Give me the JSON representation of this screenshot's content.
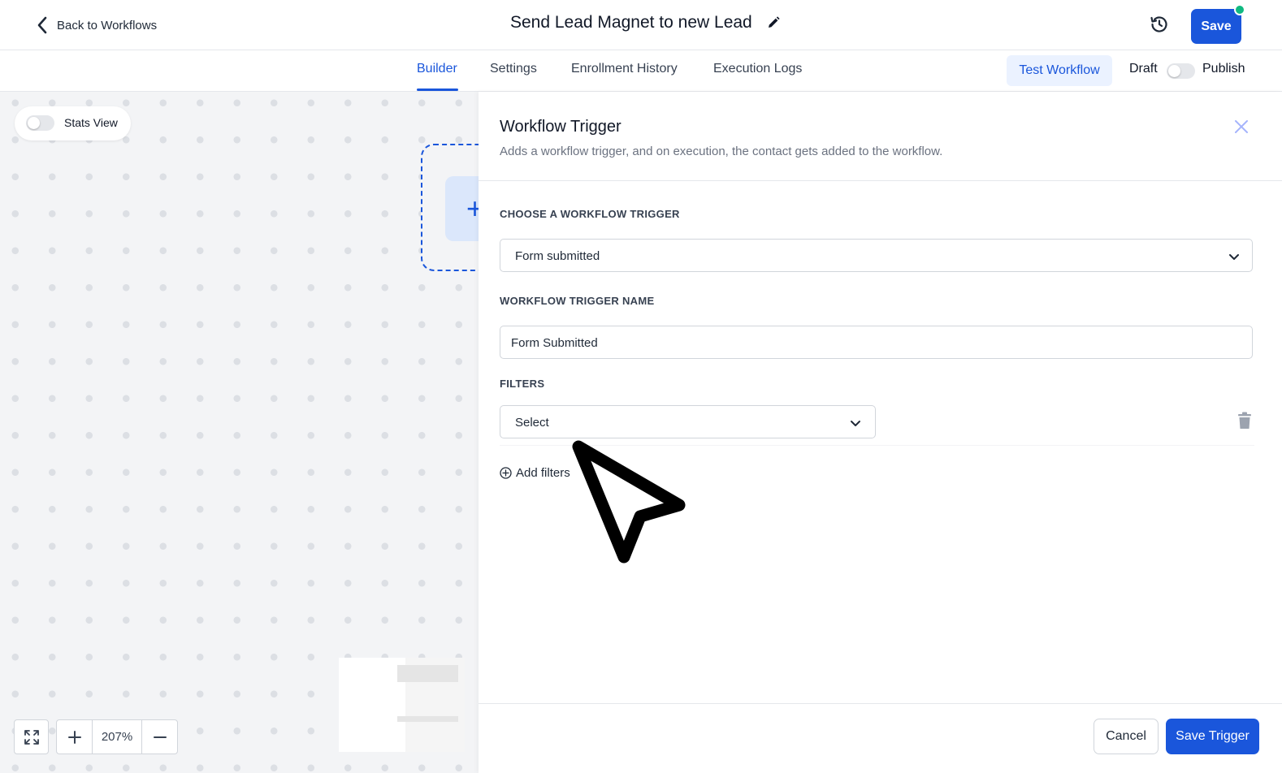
{
  "header": {
    "back_label": "Back to Workflows",
    "workflow_title": "Send Lead Magnet to new Lead",
    "save_label": "Save"
  },
  "tabs": [
    {
      "label": "Builder",
      "active": true
    },
    {
      "label": "Settings",
      "active": false
    },
    {
      "label": "Enrollment History",
      "active": false
    },
    {
      "label": "Execution Logs",
      "active": false
    }
  ],
  "actions": {
    "test_workflow_label": "Test Workflow",
    "draft_label": "Draft",
    "publish_label": "Publish",
    "published": false
  },
  "canvas": {
    "stats_view_label": "Stats View",
    "stats_view_on": false,
    "zoom_level": "207%"
  },
  "panel": {
    "title": "Workflow Trigger",
    "subtitle": "Adds a workflow trigger, and on execution, the contact gets added to the workflow.",
    "choose_trigger_label": "CHOOSE A WORKFLOW TRIGGER",
    "trigger_value": "Form submitted",
    "trigger_name_label": "WORKFLOW TRIGGER NAME",
    "trigger_name_value": "Form Submitted",
    "filters_label": "FILTERS",
    "filter_select_value": "Select",
    "add_filters_label": "Add filters",
    "cancel_label": "Cancel",
    "save_trigger_label": "Save Trigger"
  },
  "colors": {
    "primary": "#1a56db",
    "primary_light": "#ebf2ff",
    "status_dot": "#10b981",
    "canvas_bg": "#f3f4f6"
  }
}
